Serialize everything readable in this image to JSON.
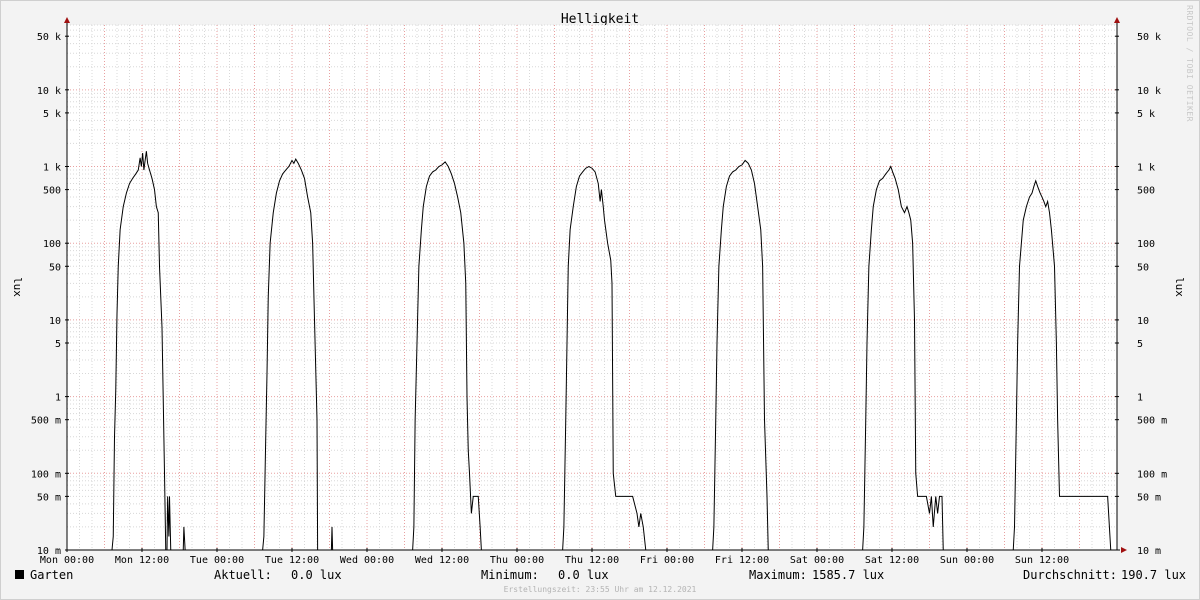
{
  "chart_data": {
    "type": "line",
    "title": "Helligkeit",
    "ylabel_left": "lux",
    "ylabel_right": "lux",
    "yscale": "log",
    "ylim": [
      0.01,
      70000
    ],
    "x_unit": "hours since Mon 00:00",
    "xlim": [
      0,
      168
    ],
    "x_ticks": [
      {
        "x": 0,
        "label": "Mon 00:00"
      },
      {
        "x": 12,
        "label": "Mon 12:00"
      },
      {
        "x": 24,
        "label": "Tue 00:00"
      },
      {
        "x": 36,
        "label": "Tue 12:00"
      },
      {
        "x": 48,
        "label": "Wed 00:00"
      },
      {
        "x": 60,
        "label": "Wed 12:00"
      },
      {
        "x": 72,
        "label": "Thu 00:00"
      },
      {
        "x": 84,
        "label": "Thu 12:00"
      },
      {
        "x": 96,
        "label": "Fri 00:00"
      },
      {
        "x": 108,
        "label": "Fri 12:00"
      },
      {
        "x": 120,
        "label": "Sat 00:00"
      },
      {
        "x": 132,
        "label": "Sat 12:00"
      },
      {
        "x": 144,
        "label": "Sun 00:00"
      },
      {
        "x": 156,
        "label": "Sun 12:00"
      }
    ],
    "y_ticks": [
      {
        "v": 0.01,
        "label": "10 m"
      },
      {
        "v": 0.05,
        "label": "50 m"
      },
      {
        "v": 0.1,
        "label": "100 m"
      },
      {
        "v": 0.5,
        "label": "500 m"
      },
      {
        "v": 1,
        "label": "1"
      },
      {
        "v": 5,
        "label": "5"
      },
      {
        "v": 10,
        "label": "10"
      },
      {
        "v": 50,
        "label": "50"
      },
      {
        "v": 100,
        "label": "100"
      },
      {
        "v": 500,
        "label": "500"
      },
      {
        "v": 1000,
        "label": "1 k"
      },
      {
        "v": 5000,
        "label": "5 k"
      },
      {
        "v": 10000,
        "label": "10 k"
      },
      {
        "v": 50000,
        "label": "50 k"
      }
    ],
    "grid": true,
    "series": [
      {
        "name": "Garten",
        "color": "#000000",
        "points": [
          [
            0,
            0.01
          ],
          [
            7.2,
            0.01
          ],
          [
            7.4,
            0.015
          ],
          [
            7.6,
            0.3
          ],
          [
            7.8,
            1.2
          ],
          [
            8.0,
            12
          ],
          [
            8.2,
            50
          ],
          [
            8.5,
            150
          ],
          [
            9,
            300
          ],
          [
            9.5,
            450
          ],
          [
            10,
            600
          ],
          [
            10.5,
            700
          ],
          [
            11,
            800
          ],
          [
            11.4,
            900
          ],
          [
            11.7,
            1300
          ],
          [
            11.9,
            1000
          ],
          [
            12.1,
            1500
          ],
          [
            12.3,
            900
          ],
          [
            12.5,
            1200
          ],
          [
            12.7,
            1585.7
          ],
          [
            12.9,
            1100
          ],
          [
            13.2,
            900
          ],
          [
            13.6,
            700
          ],
          [
            14,
            500
          ],
          [
            14.3,
            300
          ],
          [
            14.6,
            250
          ],
          [
            14.8,
            50
          ],
          [
            15.2,
            8
          ],
          [
            15.6,
            0.1
          ],
          [
            15.8,
            0.01
          ],
          [
            16.0,
            0.01
          ],
          [
            16.1,
            0.05
          ],
          [
            16.3,
            0.015
          ],
          [
            16.4,
            0.05
          ],
          [
            16.6,
            0.01
          ],
          [
            18.6,
            0.01
          ],
          [
            18.7,
            0.02
          ],
          [
            18.9,
            0.01
          ],
          [
            31.3,
            0.01
          ],
          [
            31.5,
            0.015
          ],
          [
            31.8,
            0.3
          ],
          [
            32,
            2
          ],
          [
            32.2,
            20
          ],
          [
            32.5,
            100
          ],
          [
            33,
            250
          ],
          [
            33.5,
            450
          ],
          [
            34,
            650
          ],
          [
            34.5,
            800
          ],
          [
            35,
            900
          ],
          [
            35.5,
            1000
          ],
          [
            36,
            1200
          ],
          [
            36.3,
            1100
          ],
          [
            36.6,
            1250
          ],
          [
            37,
            1100
          ],
          [
            37.5,
            900
          ],
          [
            38,
            700
          ],
          [
            38.5,
            400
          ],
          [
            39,
            250
          ],
          [
            39.3,
            100
          ],
          [
            39.6,
            10
          ],
          [
            40,
            0.5
          ],
          [
            40.1,
            0.01
          ],
          [
            42.3,
            0.01
          ],
          [
            42.4,
            0.02
          ],
          [
            42.5,
            0.01
          ],
          [
            55.3,
            0.01
          ],
          [
            55.5,
            0.02
          ],
          [
            55.7,
            0.5
          ],
          [
            56,
            5
          ],
          [
            56.3,
            50
          ],
          [
            56.7,
            150
          ],
          [
            57,
            300
          ],
          [
            57.5,
            550
          ],
          [
            58,
            750
          ],
          [
            58.5,
            850
          ],
          [
            59,
            900
          ],
          [
            59.5,
            1000
          ],
          [
            60,
            1050
          ],
          [
            60.5,
            1150
          ],
          [
            61,
            1000
          ],
          [
            61.5,
            800
          ],
          [
            62,
            600
          ],
          [
            62.5,
            400
          ],
          [
            63,
            250
          ],
          [
            63.5,
            100
          ],
          [
            63.8,
            30
          ],
          [
            64,
            1
          ],
          [
            64.2,
            0.2
          ],
          [
            64.4,
            0.1
          ],
          [
            64.7,
            0.03
          ],
          [
            65,
            0.05
          ],
          [
            65.5,
            0.05
          ],
          [
            65.8,
            0.05
          ],
          [
            66.1,
            0.02
          ],
          [
            66.3,
            0.01
          ],
          [
            79.3,
            0.01
          ],
          [
            79.5,
            0.02
          ],
          [
            79.8,
            0.5
          ],
          [
            80,
            5
          ],
          [
            80.2,
            50
          ],
          [
            80.5,
            150
          ],
          [
            81,
            300
          ],
          [
            81.5,
            550
          ],
          [
            82,
            750
          ],
          [
            82.5,
            850
          ],
          [
            83,
            950
          ],
          [
            83.5,
            1000
          ],
          [
            84,
            950
          ],
          [
            84.5,
            850
          ],
          [
            85,
            600
          ],
          [
            85.3,
            350
          ],
          [
            85.5,
            500
          ],
          [
            85.8,
            300
          ],
          [
            86,
            200
          ],
          [
            86.5,
            100
          ],
          [
            87,
            60
          ],
          [
            87.2,
            30
          ],
          [
            87.4,
            0.1
          ],
          [
            87.8,
            0.05
          ],
          [
            90,
            0.05
          ],
          [
            90.5,
            0.05
          ],
          [
            91.2,
            0.03
          ],
          [
            91.5,
            0.02
          ],
          [
            91.8,
            0.03
          ],
          [
            92.2,
            0.02
          ],
          [
            92.6,
            0.01
          ],
          [
            103.3,
            0.01
          ],
          [
            103.5,
            0.02
          ],
          [
            103.8,
            0.5
          ],
          [
            104,
            5
          ],
          [
            104.3,
            50
          ],
          [
            104.7,
            150
          ],
          [
            105,
            300
          ],
          [
            105.5,
            550
          ],
          [
            106,
            750
          ],
          [
            106.5,
            850
          ],
          [
            107,
            900
          ],
          [
            107.5,
            1000
          ],
          [
            108,
            1050
          ],
          [
            108.5,
            1200
          ],
          [
            109,
            1100
          ],
          [
            109.5,
            900
          ],
          [
            110,
            600
          ],
          [
            110.5,
            300
          ],
          [
            111,
            150
          ],
          [
            111.3,
            50
          ],
          [
            111.6,
            0.5
          ],
          [
            112,
            0.05
          ],
          [
            112.2,
            0.01
          ],
          [
            127.3,
            0.01
          ],
          [
            127.5,
            0.02
          ],
          [
            127.8,
            0.5
          ],
          [
            128,
            5
          ],
          [
            128.3,
            50
          ],
          [
            128.7,
            150
          ],
          [
            129,
            300
          ],
          [
            129.5,
            500
          ],
          [
            130,
            650
          ],
          [
            130.5,
            700
          ],
          [
            131,
            800
          ],
          [
            131.5,
            900
          ],
          [
            131.8,
            1000
          ],
          [
            132.1,
            850
          ],
          [
            132.5,
            700
          ],
          [
            133,
            500
          ],
          [
            133.5,
            300
          ],
          [
            134,
            250
          ],
          [
            134.4,
            300
          ],
          [
            134.7,
            250
          ],
          [
            135,
            200
          ],
          [
            135.3,
            100
          ],
          [
            135.6,
            10
          ],
          [
            135.8,
            0.1
          ],
          [
            136.1,
            0.05
          ],
          [
            137.5,
            0.05
          ],
          [
            138,
            0.03
          ],
          [
            138.3,
            0.05
          ],
          [
            138.6,
            0.02
          ],
          [
            139,
            0.05
          ],
          [
            139.3,
            0.03
          ],
          [
            139.6,
            0.05
          ],
          [
            140,
            0.05
          ],
          [
            140.2,
            0.01
          ],
          [
            151.4,
            0.01
          ],
          [
            151.6,
            0.02
          ],
          [
            151.9,
            0.5
          ],
          [
            152.1,
            5
          ],
          [
            152.4,
            50
          ],
          [
            152.7,
            100
          ],
          [
            153,
            200
          ],
          [
            153.5,
            300
          ],
          [
            154,
            400
          ],
          [
            154.4,
            450
          ],
          [
            154.7,
            550
          ],
          [
            155,
            650
          ],
          [
            155.3,
            550
          ],
          [
            155.7,
            450
          ],
          [
            156,
            400
          ],
          [
            156.3,
            350
          ],
          [
            156.6,
            300
          ],
          [
            156.9,
            350
          ],
          [
            157.2,
            250
          ],
          [
            157.5,
            150
          ],
          [
            158,
            50
          ],
          [
            158.3,
            5
          ],
          [
            158.5,
            0.5
          ],
          [
            158.8,
            0.05
          ],
          [
            163.5,
            0.05
          ],
          [
            166.5,
            0.05
          ],
          [
            167,
            0.01
          ],
          [
            168,
            0.01
          ]
        ]
      }
    ]
  },
  "legend": {
    "series_name": "Garten",
    "aktuell_label": "Aktuell:",
    "aktuell_value": "0.0 lux",
    "minimum_label": "Minimum:",
    "minimum_value": "0.0 lux",
    "maximum_label": "Maximum:",
    "maximum_value": "1585.7 lux",
    "avg_label": "Durchschnitt:",
    "avg_value": "190.7 lux"
  },
  "watermark": "RRDTOOL / TOBI OETIKER",
  "footer": "Erstellungszeit: 23:55 Uhr am 12.12.2021",
  "colors": {
    "background": "#f3f3f3",
    "plot_background": "#ffffff",
    "major_grid": "#e8a0a0",
    "minor_grid": "#d8d8d8",
    "line": "#000000",
    "arrow": "#a01010"
  }
}
